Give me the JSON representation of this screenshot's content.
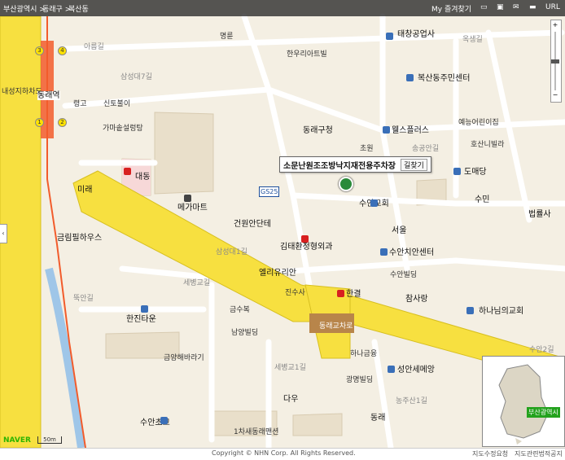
{
  "breadcrumb": [
    "부산광역시 >",
    "동래구 >",
    "복산동"
  ],
  "toolbar": [
    "My 즐겨찾기",
    "URL"
  ],
  "callout": {
    "name": "소문난원조조방낙지재전용주차장",
    "directions": "길찾기"
  },
  "stations": {
    "name": "동래역",
    "line_left": "내성지하차도",
    "badges": [
      "1",
      "3",
      "4",
      "2"
    ]
  },
  "labels": {
    "myeongnyun": "명륜",
    "hanuri": "한우리아트빌",
    "taechang": "태창공업사",
    "oksaenggil": "옥생길",
    "boksan_center": "복산동주민센터",
    "hospital": "예능어린이집",
    "hoan": "호산니빌라",
    "arreumgil": "아름길",
    "samsungdaegil": "삼성대7길",
    "ryunggo": "령고",
    "sinroburi": "신토불이",
    "garden": "가마솥설렁탕",
    "dongraegucheong": "동래구청",
    "wellsplus": "웰스플러스",
    "chowon": "초원",
    "songgongangil": "송공안길",
    "domaedang": "도매당",
    "sumin": "수민",
    "beopryul": "법률사",
    "daedong": "대동",
    "mega": "메가마트",
    "mirae": "미래",
    "geumyeong": "금림필하우스",
    "geonwon": "건원안단테",
    "gimtaehwan": "김태환정형외과",
    "elyou": "엘리유리안",
    "jinsusa": "진수사",
    "suan_church": "수안교회",
    "seoul": "서울",
    "suan_center": "수안치안센터",
    "suan_market": "수안빌딩",
    "chamsarang": "참사랑",
    "hananim": "하나님의교회",
    "hangyeol": "한결",
    "geumsubok": "금수복",
    "namyang": "남양빌딩",
    "hanjintown": "한진타운",
    "geumyang": "금양해바라기",
    "suanchoseung": "수안초교",
    "cheondong": "1차새동래맨션",
    "hanagumyeong": "하나금융",
    "seongahn": "성안세메앙",
    "gwangmyeong": "광명빌딩",
    "dau": "다우",
    "dongrae": "동래",
    "dongraegyocharo": "동래교차로",
    "samsungdae1gil": "삼성대1길",
    "sesanggyo": "세병교길",
    "sesanggyo1": "세병교1길",
    "nonggul": "농주산1길",
    "ttukangil": "뚝안길",
    "jungang2gil": "수안2길",
    "gs": "GS25"
  },
  "inset": {
    "tag": "부산광역시"
  },
  "scale": "50m",
  "brand": "NAVER",
  "footer": {
    "copyright": "Copyright © NHN Corp. All Rights Reserved.",
    "links": [
      "지도수정요청",
      "지도관련법적공지"
    ]
  },
  "colors": {
    "road_major": "#f7e040",
    "road_minor": "#ffffff",
    "block": "#ece4d2",
    "subway": "#f25c2c",
    "water": "#9fc6e8"
  }
}
